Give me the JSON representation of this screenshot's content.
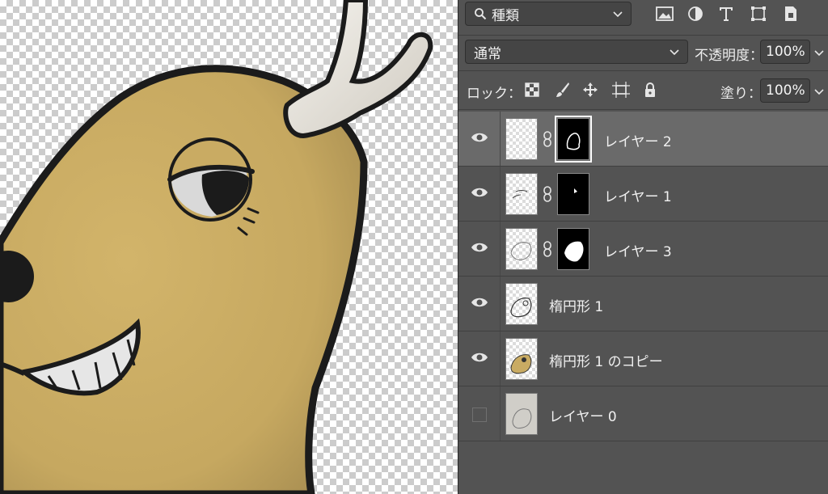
{
  "filter": {
    "label": "種類"
  },
  "blend": {
    "mode": "通常",
    "opacity_label": "不透明度：",
    "opacity_value": "100%"
  },
  "lock": {
    "label": "ロック：",
    "fill_label": "塗り：",
    "fill_value": "100%"
  },
  "filter_icons": [
    "image-icon",
    "adjustment-icon",
    "type-icon",
    "shape-icon",
    "smart-object-icon"
  ],
  "lock_icons": [
    "lock-transparent-icon",
    "lock-paint-icon",
    "lock-move-icon",
    "lock-artboard-icon",
    "lock-all-icon"
  ],
  "layers": [
    {
      "name": "レイヤー 2",
      "visible": true,
      "selected": true,
      "mask": true
    },
    {
      "name": "レイヤー 1",
      "visible": true,
      "selected": false,
      "mask": true
    },
    {
      "name": "レイヤー 3",
      "visible": true,
      "selected": false,
      "mask": true
    },
    {
      "name": "楕円形 1",
      "visible": true,
      "selected": false,
      "mask": false
    },
    {
      "name": "楕円形 1 のコピー",
      "visible": true,
      "selected": false,
      "mask": false
    },
    {
      "name": "レイヤー 0",
      "visible": false,
      "selected": false,
      "mask": false
    }
  ],
  "colors": {
    "panel": "#535353",
    "selected_row": "#6a6a6a",
    "deer_fill": "#c9ab63",
    "antler": "#e9e6df"
  }
}
